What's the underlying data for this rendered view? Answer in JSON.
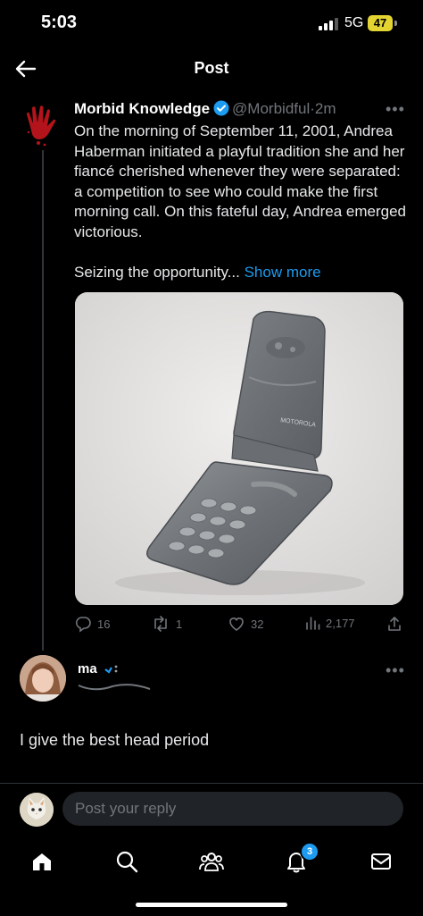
{
  "status_bar": {
    "time": "5:03",
    "network": "5G",
    "battery": "47"
  },
  "header": {
    "title": "Post"
  },
  "post": {
    "author": "Morbid Knowledge",
    "handle": "@Morbidful",
    "separator": "·",
    "age": "2m",
    "text_p1": "On the morning of September 11, 2001, Andrea Haberman initiated a playful tradition she and her fiancé cherished whenever they were separated: a competition to see who could make the first morning call. On this fateful day, Andrea emerged victorious.",
    "text_p2": "Seizing the opportunity...",
    "show_more": "Show more",
    "image_label": "MOTOROLA",
    "stats": {
      "replies": "16",
      "reposts": "1",
      "likes": "32",
      "views": "2,177"
    }
  },
  "reply": {
    "name_visible": "ma",
    "text": "I give the best head period"
  },
  "composer": {
    "placeholder": "Post your reply"
  },
  "tab_bar": {
    "notifications_badge": "3"
  },
  "colors": {
    "accent": "#1d9bf0",
    "background": "#000000",
    "muted": "#71767b",
    "battery": "#e3d431"
  },
  "icons": [
    "back-arrow-icon",
    "verified-badge-icon",
    "more-icon",
    "reply-icon",
    "repost-icon",
    "like-icon",
    "views-icon",
    "share-icon",
    "home-icon",
    "search-icon",
    "communities-icon",
    "notifications-icon",
    "messages-icon"
  ]
}
